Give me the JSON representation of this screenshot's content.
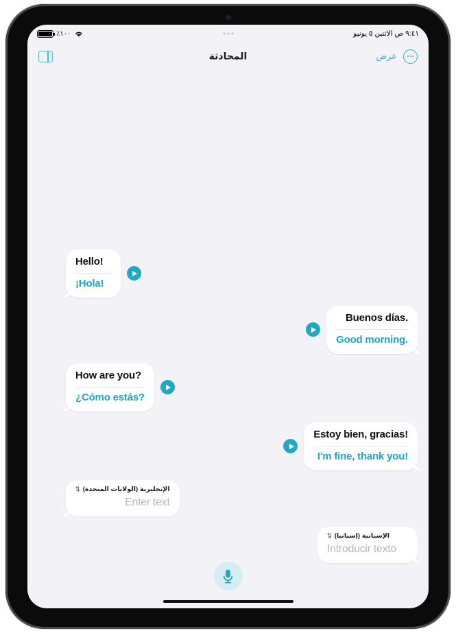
{
  "status_bar": {
    "battery_percent": "١٠٠٪",
    "time_date": "٩:٤١ ص   الاثنين ٥ يونيو",
    "battery_icon": "battery-icon",
    "wifi_icon": "wifi-icon"
  },
  "nav_bar": {
    "view_label": "عرض",
    "title": "المحادثة",
    "more_icon": "ellipsis-circle-icon",
    "sidebar_icon": "sidebar-toggle-icon"
  },
  "messages": [
    {
      "side": "left",
      "source": "Hello!",
      "translation": "¡Hola!",
      "play_label": "play-icon"
    },
    {
      "side": "right",
      "source": "Buenos días.",
      "translation": "Good morning.",
      "play_label": "play-icon"
    },
    {
      "side": "left",
      "source": "How are you?",
      "translation": "¿Cómo estás?",
      "play_label": "play-icon"
    },
    {
      "side": "right",
      "source": "Estoy bien, gracias!",
      "translation": "I'm fine, thank you!",
      "play_label": "play-icon"
    }
  ],
  "inputs": [
    {
      "side": "left",
      "language": "الإنجليزية (الولايات المتحدة)",
      "chevron": "⇅",
      "placeholder": "Enter text",
      "value": ""
    },
    {
      "side": "right",
      "language": "الإسبانية (إسبانيا)",
      "chevron": "⇅",
      "placeholder": "Introducir texto",
      "value": ""
    }
  ],
  "mic_button": {
    "icon": "microphone-icon",
    "background": "#d4eef4",
    "color": "#2ba5c0"
  },
  "colors": {
    "accent": "#22a8c6",
    "translation_text": "#1aa7c8",
    "source_text": "#111111",
    "app_background": "#f2f2f7",
    "bubble": "#ffffff",
    "placeholder": "#b9b9be"
  }
}
